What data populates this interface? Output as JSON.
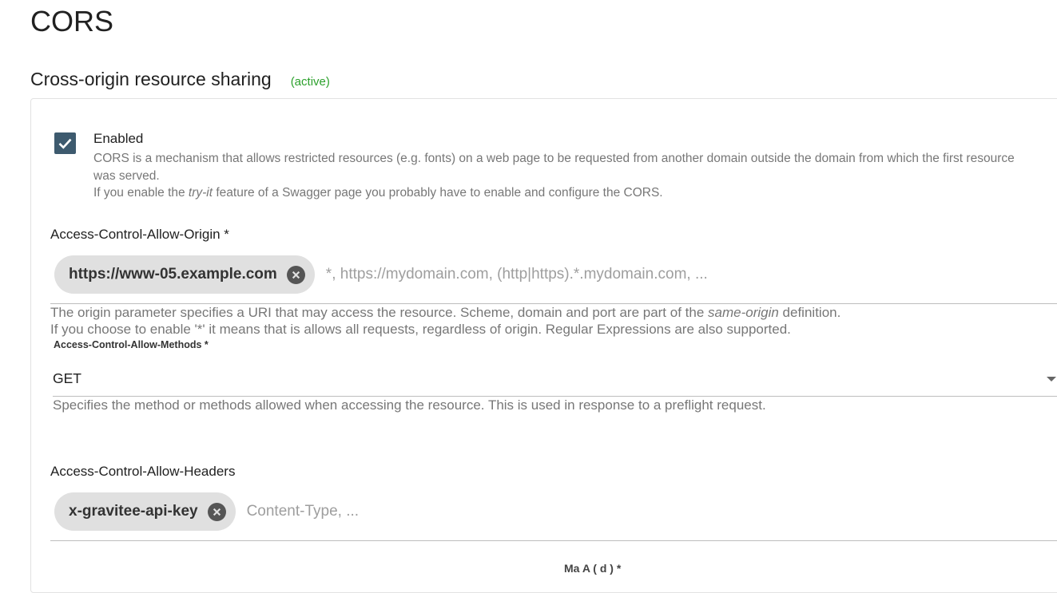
{
  "page": {
    "title": "CORS"
  },
  "section": {
    "title": "Cross-origin resource sharing",
    "status": "(active)",
    "status_color": "#2ca02c"
  },
  "enabled": {
    "label": "Enabled",
    "checked": true,
    "desc_line1": "CORS is a mechanism that allows restricted resources (e.g. fonts) on a web page to be requested from another domain outside the domain from which the first resource was served.",
    "desc_line2_pre": "If you enable the ",
    "desc_line2_em": "try-it",
    "desc_line2_post": " feature of a Swagger page you probably have to enable and configure the CORS."
  },
  "allow_origin": {
    "label": "Access-Control-Allow-Origin *",
    "chips": [
      "https://www-05.example.com"
    ],
    "placeholder": "*, https://mydomain.com, (http|https).*.mydomain.com, ...",
    "hint1_pre": "The origin parameter specifies a URI that may access the resource. Scheme, domain and port are part of the ",
    "hint1_em": "same-origin",
    "hint1_post": " definition.",
    "hint2": "If you choose to enable '*' it means that is allows all requests, regardless of origin. Regular Expressions are also supported."
  },
  "allow_methods": {
    "label": "Access-Control-Allow-Methods *",
    "value": "GET",
    "hint": "Specifies the method or methods allowed when accessing the resource. This is used in response to a preflight request."
  },
  "allow_headers": {
    "label": "Access-Control-Allow-Headers",
    "chips": [
      "x-gravitee-api-key"
    ],
    "placeholder": "Content-Type, ..."
  },
  "next_field": {
    "label_partial": "Ma  A  (  d ) *"
  },
  "icons": {
    "checkbox": "check-icon",
    "chip_remove": "close-circle-icon",
    "dropdown": "chevron-down-icon"
  }
}
